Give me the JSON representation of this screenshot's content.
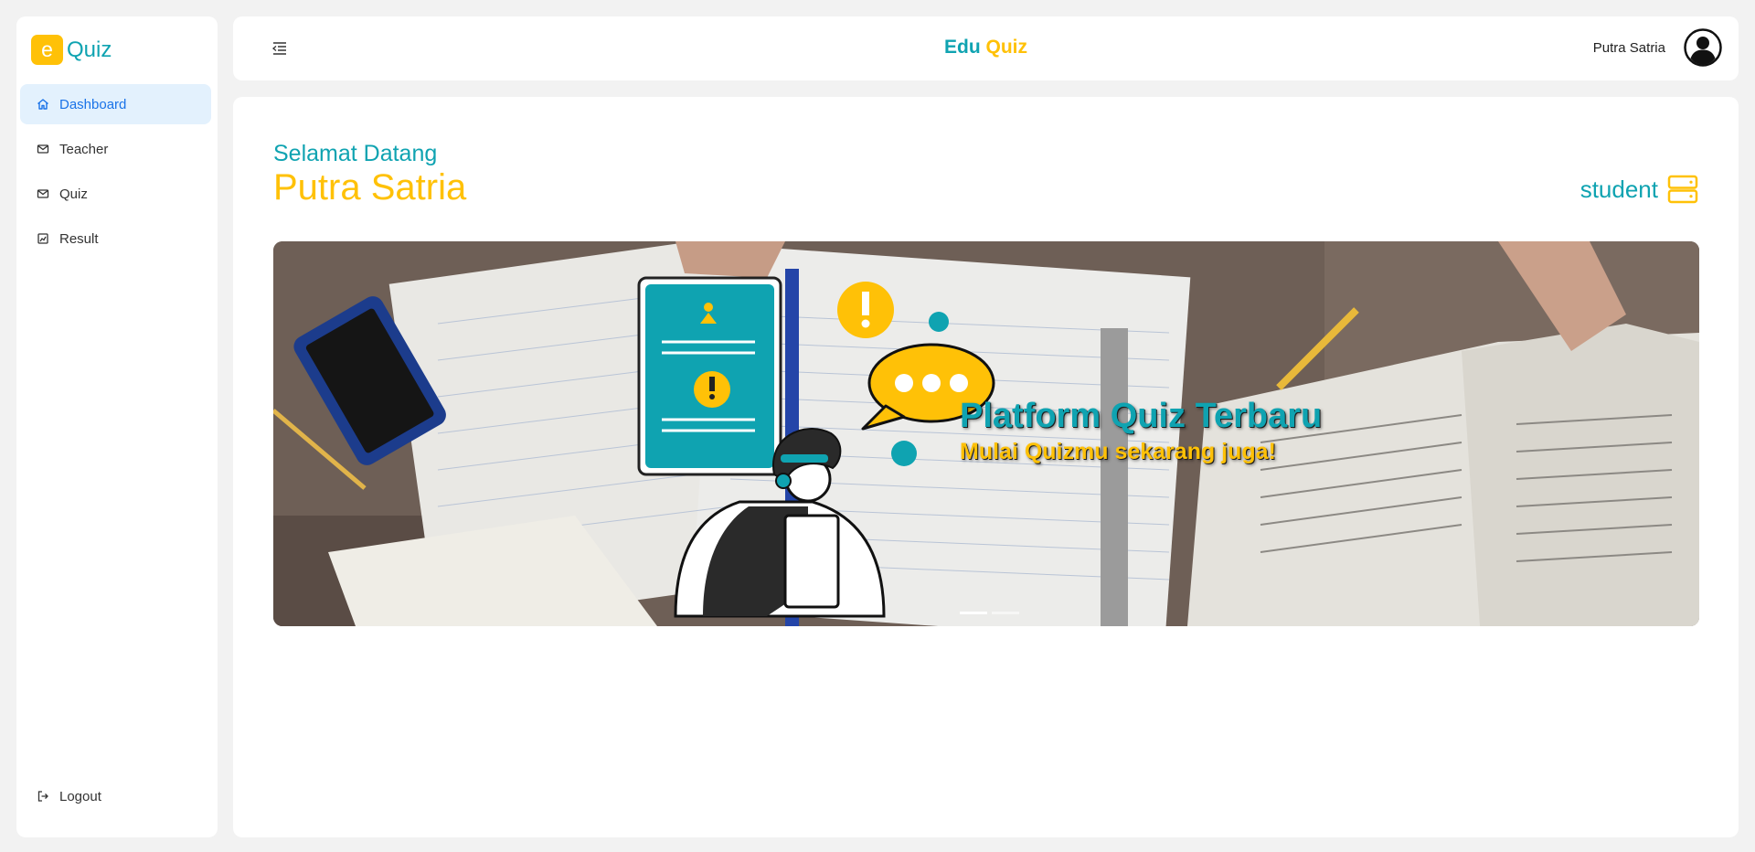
{
  "logo": {
    "letter": "e",
    "text": "Quiz"
  },
  "sidebar": {
    "items": [
      {
        "label": "Dashboard",
        "icon": "home-icon",
        "active": true
      },
      {
        "label": "Teacher",
        "icon": "mail-icon"
      },
      {
        "label": "Quiz",
        "icon": "mail-icon"
      },
      {
        "label": "Result",
        "icon": "chart-icon"
      }
    ],
    "logout": {
      "label": "Logout",
      "icon": "logout-icon"
    }
  },
  "header": {
    "brand_part1": "Edu",
    "brand_part2": "Quiz",
    "user_name": "Putra Satria"
  },
  "main": {
    "greeting": "Selamat Datang",
    "user_name": "Putra Satria",
    "role": "student",
    "banner": {
      "title": "Platform Quiz Terbaru",
      "subtitle": "Mulai Quizmu sekarang juga!",
      "slides": 2,
      "active_slide": 1
    }
  },
  "colors": {
    "accent_teal": "#0fa3b1",
    "accent_yellow": "#ffc107",
    "active_nav_bg": "#e3f1fd",
    "active_nav_text": "#1a73e8"
  }
}
